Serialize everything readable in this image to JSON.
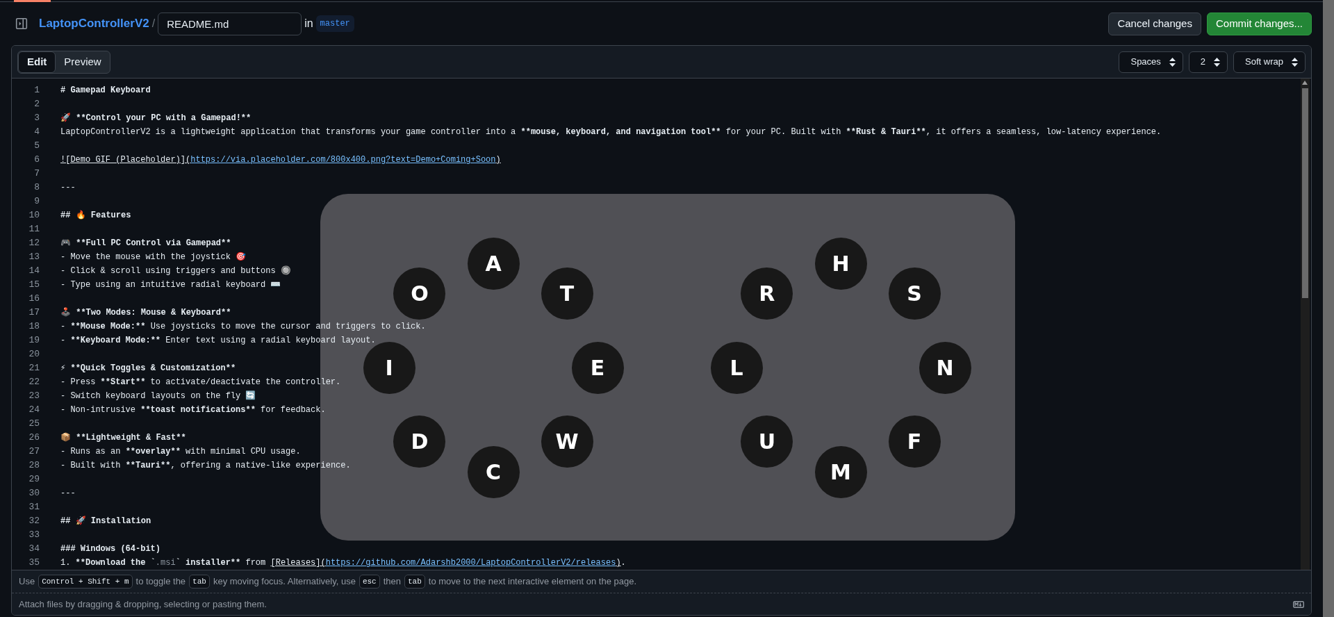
{
  "header": {
    "repository": "LaptopControllerV2",
    "separator": "/",
    "filename": "README.md",
    "branch_prefix": "in",
    "branch": "master",
    "buttons": [
      {
        "label": "Cancel changes",
        "kind": "secondary"
      },
      {
        "label": "Commit changes...",
        "kind": "primary"
      }
    ]
  },
  "editor": {
    "tabs": [
      {
        "label": "Edit",
        "selected": true
      },
      {
        "label": "Preview",
        "selected": false
      }
    ],
    "settings": [
      {
        "value": "Spaces"
      },
      {
        "value": "2"
      },
      {
        "value": "Soft wrap"
      }
    ],
    "lines": [
      {
        "number": "1",
        "segments": [
          {
            "text": "# Gamepad Keyboard",
            "kind": "bold"
          }
        ]
      },
      {
        "number": "2"
      },
      {
        "number": "3",
        "segments": [
          {
            "text": "🚀 ",
            "kind": "plain"
          },
          {
            "text": "**Control your PC with a Gamepad!**",
            "kind": "bold"
          }
        ]
      },
      {
        "number": "4",
        "segments": [
          {
            "text": "LaptopControllerV2 is a lightweight application that transforms your game controller into a ",
            "kind": "plain"
          },
          {
            "text": "**mouse, keyboard, and navigation tool**",
            "kind": "bold"
          },
          {
            "text": " for your PC. Built with ",
            "kind": "plain"
          },
          {
            "text": "**Rust & Tauri**",
            "kind": "bold"
          },
          {
            "text": ", it offers a seamless, low-latency experience.",
            "kind": "plain"
          }
        ]
      },
      {
        "number": "5"
      },
      {
        "number": "6",
        "segments": [
          {
            "text": "![Demo GIF (Placeholder)](",
            "kind": "underline"
          },
          {
            "text": "https://via.placeholder.com/800x400.png?text=Demo+Coming+Soon",
            "kind": "link"
          },
          {
            "text": ")",
            "kind": "underline"
          }
        ]
      },
      {
        "number": "7"
      },
      {
        "number": "8",
        "segments": [
          {
            "text": "---",
            "kind": "plain"
          }
        ]
      },
      {
        "number": "9"
      },
      {
        "number": "10",
        "segments": [
          {
            "text": "## 🔥 Features",
            "kind": "bold"
          }
        ]
      },
      {
        "number": "11"
      },
      {
        "number": "12",
        "segments": [
          {
            "text": "🎮 ",
            "kind": "plain"
          },
          {
            "text": "**Full PC Control via Gamepad**",
            "kind": "bold"
          }
        ]
      },
      {
        "number": "13",
        "segments": [
          {
            "text": "- Move the mouse with the joystick 🎯",
            "kind": "plain"
          }
        ]
      },
      {
        "number": "14",
        "segments": [
          {
            "text": "- Click & scroll using triggers and buttons 🔘",
            "kind": "plain"
          }
        ]
      },
      {
        "number": "15",
        "segments": [
          {
            "text": "- Type using an intuitive radial keyboard ⌨️",
            "kind": "plain"
          }
        ]
      },
      {
        "number": "16"
      },
      {
        "number": "17",
        "segments": [
          {
            "text": "🕹️ ",
            "kind": "plain"
          },
          {
            "text": "**Two Modes: Mouse & Keyboard**",
            "kind": "bold"
          }
        ]
      },
      {
        "number": "18",
        "segments": [
          {
            "text": "- ",
            "kind": "plain"
          },
          {
            "text": "**Mouse Mode:**",
            "kind": "bold"
          },
          {
            "text": " Use joysticks to move the cursor and triggers to click.",
            "kind": "plain"
          }
        ]
      },
      {
        "number": "19",
        "segments": [
          {
            "text": "- ",
            "kind": "plain"
          },
          {
            "text": "**Keyboard Mode:**",
            "kind": "bold"
          },
          {
            "text": " Enter text using a radial keyboard layout.",
            "kind": "plain"
          }
        ]
      },
      {
        "number": "20"
      },
      {
        "number": "21",
        "segments": [
          {
            "text": "⚡ ",
            "kind": "plain"
          },
          {
            "text": "**Quick Toggles & Customization**",
            "kind": "bold"
          }
        ]
      },
      {
        "number": "22",
        "segments": [
          {
            "text": "- Press ",
            "kind": "plain"
          },
          {
            "text": "**Start**",
            "kind": "bold"
          },
          {
            "text": " to activate/deactivate the controller.",
            "kind": "plain"
          }
        ]
      },
      {
        "number": "23",
        "segments": [
          {
            "text": "- Switch keyboard layouts on the fly 🔄",
            "kind": "plain"
          }
        ]
      },
      {
        "number": "24",
        "segments": [
          {
            "text": "- Non-intrusive ",
            "kind": "plain"
          },
          {
            "text": "**toast notifications**",
            "kind": "bold"
          },
          {
            "text": " for feedback.",
            "kind": "plain"
          }
        ]
      },
      {
        "number": "25"
      },
      {
        "number": "26",
        "segments": [
          {
            "text": "📦 ",
            "kind": "plain"
          },
          {
            "text": "**Lightweight & Fast**",
            "kind": "bold"
          }
        ]
      },
      {
        "number": "27",
        "segments": [
          {
            "text": "- Runs as an ",
            "kind": "plain"
          },
          {
            "text": "**overlay**",
            "kind": "bold"
          },
          {
            "text": " with minimal CPU usage.",
            "kind": "plain"
          }
        ]
      },
      {
        "number": "28",
        "segments": [
          {
            "text": "- Built with ",
            "kind": "plain"
          },
          {
            "text": "**Tauri**",
            "kind": "bold"
          },
          {
            "text": ", offering a native-like experience.",
            "kind": "plain"
          }
        ]
      },
      {
        "number": "29"
      },
      {
        "number": "30",
        "segments": [
          {
            "text": "---",
            "kind": "plain"
          }
        ]
      },
      {
        "number": "31"
      },
      {
        "number": "32",
        "segments": [
          {
            "text": "## 🚀 Installation",
            "kind": "bold"
          }
        ]
      },
      {
        "number": "33"
      },
      {
        "number": "34",
        "segments": [
          {
            "text": "### Windows (64-bit)",
            "kind": "bold"
          }
        ]
      },
      {
        "number": "35",
        "segments": [
          {
            "text": "1. ",
            "kind": "plain"
          },
          {
            "text": "**Download the `",
            "kind": "bold"
          },
          {
            "text": ".msi",
            "kind": "code"
          },
          {
            "text": "` installer**",
            "kind": "bold"
          },
          {
            "text": " from ",
            "kind": "plain"
          },
          {
            "text": "[Releases](",
            "kind": "underline"
          },
          {
            "text": "https://github.com/Adarshb2000/LaptopControllerV2/releases",
            "kind": "link"
          },
          {
            "text": ")",
            "kind": "underline"
          },
          {
            "text": ".",
            "kind": "plain"
          }
        ]
      }
    ]
  },
  "overlay": {
    "wheels": [
      {
        "keys": [
          "A",
          "T",
          "E",
          "W",
          "C",
          "D",
          "I",
          "O"
        ]
      },
      {
        "keys": [
          "H",
          "S",
          "N",
          "F",
          "M",
          "U",
          "L",
          "R"
        ]
      }
    ]
  },
  "footer": {
    "hint": [
      {
        "text": "Use ",
        "kind": "text"
      },
      {
        "text": "Control + Shift + m",
        "kind": "key"
      },
      {
        "text": "to toggle the",
        "kind": "text"
      },
      {
        "text": "tab",
        "kind": "key"
      },
      {
        "text": "key moving focus. Alternatively, use",
        "kind": "text"
      },
      {
        "text": "esc",
        "kind": "key"
      },
      {
        "text": "then",
        "kind": "text"
      },
      {
        "text": "tab",
        "kind": "key"
      },
      {
        "text": "to move to the next interactive element on the page.",
        "kind": "text"
      }
    ],
    "attach": "Attach files by dragging & dropping, selecting or pasting them."
  }
}
